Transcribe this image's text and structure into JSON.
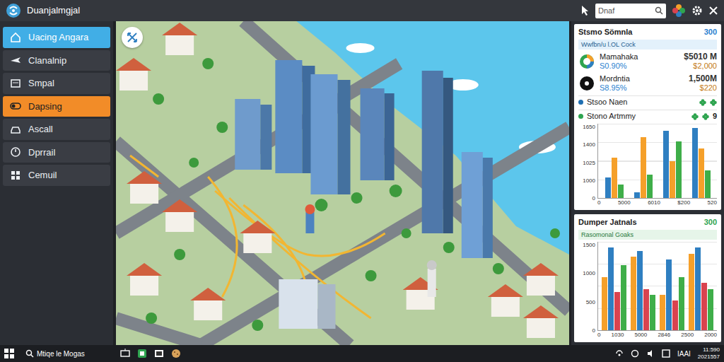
{
  "window": {
    "title": "Duanjalmgjal"
  },
  "search": {
    "placeholder": "Dnaf"
  },
  "sidebar": {
    "items": [
      {
        "label": "Uacing Angara",
        "selected": true,
        "highlighted": false
      },
      {
        "label": "Clanalnip",
        "selected": false,
        "highlighted": false
      },
      {
        "label": "Smpal",
        "selected": false,
        "highlighted": false
      },
      {
        "label": "Dapsing",
        "selected": false,
        "highlighted": true
      },
      {
        "label": "Ascall",
        "selected": false,
        "highlighted": false
      },
      {
        "label": "Dprrail",
        "selected": false,
        "highlighted": false
      },
      {
        "label": "Cemuil",
        "selected": false,
        "highlighted": false
      }
    ]
  },
  "stats_card": {
    "title": "Stsmo Sömnla",
    "badge": "300",
    "subtitle": "Wwfbn/u l.OL Cock",
    "rows": [
      {
        "name": "Mamahaka",
        "change": "S0.90%",
        "value": "$5010 M",
        "sub_value": "$2,000"
      },
      {
        "name": "Mordntia",
        "change": "S8.95%",
        "value": "1,500M",
        "sub_value": "$220"
      }
    ],
    "items": [
      {
        "label": "Stsoo Naen",
        "color": "#1f6fb2"
      },
      {
        "label": "Stono Artmmy",
        "count": "9",
        "color": "#2ea44f"
      }
    ],
    "chart": {
      "y_ticks": [
        "1650",
        "1400",
        "1025",
        "1000",
        "0"
      ],
      "x_labels": [
        "0",
        "5000",
        "6010",
        "$200",
        "520"
      ],
      "series": [
        {
          "color": "#2f7fc1",
          "values": [
            450,
            120,
            1500,
            1550
          ]
        },
        {
          "color": "#f5a02a",
          "values": [
            900,
            1350,
            820,
            1100
          ]
        },
        {
          "color": "#3fae49",
          "values": [
            300,
            520,
            1250,
            620
          ]
        }
      ]
    }
  },
  "journals_card": {
    "title": "Dumper Jatnals",
    "badge": "300",
    "subtitle": "Rasomonal Goaks",
    "chart": {
      "y_ticks": [
        "1500",
        "1000",
        "500",
        "0"
      ],
      "x_labels": [
        "0",
        "1030",
        "5000",
        "2846",
        "2500",
        "2000"
      ],
      "series": [
        {
          "color": "#f5a02a",
          "values": [
            900,
            1250,
            600,
            1300
          ]
        },
        {
          "color": "#2f7fc1",
          "values": [
            1400,
            1350,
            1200,
            1400
          ]
        },
        {
          "color": "#d9434f",
          "values": [
            650,
            700,
            500,
            800
          ]
        },
        {
          "color": "#3fae49",
          "values": [
            1100,
            600,
            900,
            700
          ]
        }
      ]
    }
  },
  "taskbar": {
    "search": "Mtiqe le Mogas",
    "tray_label": "IAAI",
    "time": "11:590",
    "date": "2021557"
  }
}
